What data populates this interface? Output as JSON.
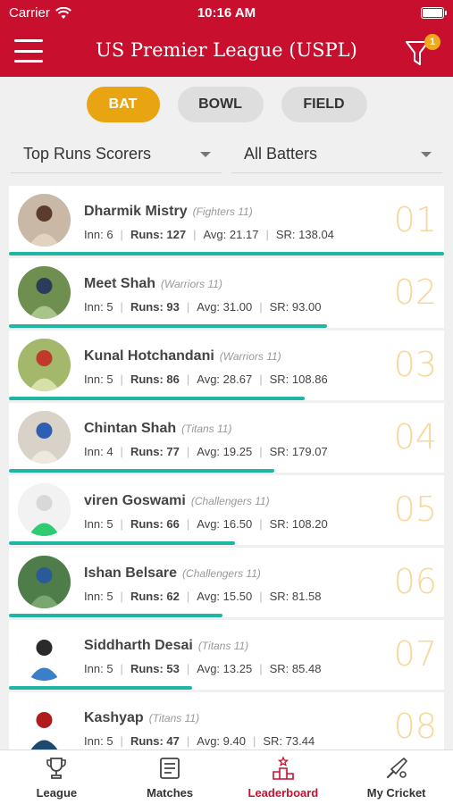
{
  "status_bar": {
    "carrier": "Carrier",
    "time": "10:16 AM"
  },
  "header": {
    "title": "US Premier League (USPL)",
    "filter_badge": "1"
  },
  "tabs": [
    {
      "label": "BAT",
      "active": true
    },
    {
      "label": "BOWL",
      "active": false
    },
    {
      "label": "FIELD",
      "active": false
    }
  ],
  "filters": {
    "category": "Top Runs Scorers",
    "batters": "All Batters"
  },
  "labels": {
    "inn": "Inn:",
    "runs": "Runs:",
    "avg": "Avg:",
    "sr": "SR:"
  },
  "players": [
    {
      "name": "Dharmik Mistry",
      "team": "(Fighters 11)",
      "inn": "6",
      "runs": "127",
      "avg": "21.17",
      "sr": "138.04",
      "rank": "01",
      "progress": 1.0
    },
    {
      "name": "Meet Shah",
      "team": "(Warriors 11)",
      "inn": "5",
      "runs": "93",
      "avg": "31.00",
      "sr": "93.00",
      "rank": "02",
      "progress": 0.73
    },
    {
      "name": "Kunal Hotchandani",
      "team": "(Warriors 11)",
      "inn": "5",
      "runs": "86",
      "avg": "28.67",
      "sr": "108.86",
      "rank": "03",
      "progress": 0.68
    },
    {
      "name": "Chintan Shah",
      "team": "(Titans 11)",
      "inn": "4",
      "runs": "77",
      "avg": "19.25",
      "sr": "179.07",
      "rank": "04",
      "progress": 0.61
    },
    {
      "name": "viren Goswami",
      "team": "(Challengers 11)",
      "inn": "5",
      "runs": "66",
      "avg": "16.50",
      "sr": "108.20",
      "rank": "05",
      "progress": 0.52
    },
    {
      "name": "Ishan Belsare",
      "team": "(Challengers 11)",
      "inn": "5",
      "runs": "62",
      "avg": "15.50",
      "sr": "81.58",
      "rank": "06",
      "progress": 0.49
    },
    {
      "name": "Siddharth Desai",
      "team": "(Titans 11)",
      "inn": "5",
      "runs": "53",
      "avg": "13.25",
      "sr": "85.48",
      "rank": "07",
      "progress": 0.42
    },
    {
      "name": "Kashyap",
      "team": "(Titans 11)",
      "inn": "5",
      "runs": "47",
      "avg": "9.40",
      "sr": "73.44",
      "rank": "08",
      "progress": 0.37
    }
  ],
  "bottom_nav": [
    {
      "label": "League",
      "icon": "trophy-icon",
      "active": false
    },
    {
      "label": "Matches",
      "icon": "matches-icon",
      "active": false
    },
    {
      "label": "Leaderboard",
      "icon": "leaderboard-icon",
      "active": true
    },
    {
      "label": "My Cricket",
      "icon": "cricket-bat-icon",
      "active": false
    }
  ],
  "colors": {
    "brand": "#c8102e",
    "accent": "#e8a511",
    "progress": "#1fb7a3",
    "rank": "#f7d79c"
  }
}
